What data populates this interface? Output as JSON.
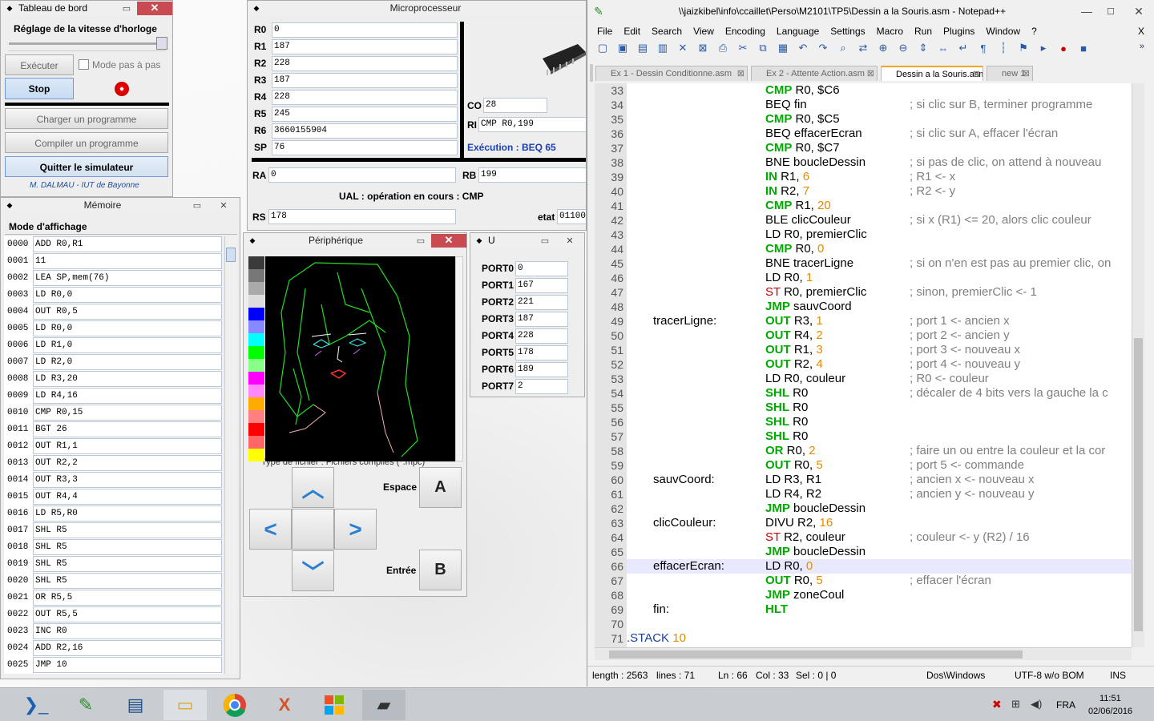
{
  "tableau": {
    "title": "Tableau de bord",
    "speed_label": "Réglage de la vitesse d'horloge",
    "exec": "Exécuter",
    "step": "Mode pas à pas",
    "stop": "Stop",
    "load": "Charger un programme",
    "compile": "Compiler un programme",
    "quit": "Quitter le simulateur",
    "credit": "M. DALMAU - IUT de Bayonne"
  },
  "memoire": {
    "title": "Mémoire",
    "mode": "Mode d'affichage",
    "rows": [
      {
        "a": "0000",
        "v": "ADD R0,R1"
      },
      {
        "a": "0001",
        "v": "11"
      },
      {
        "a": "0002",
        "v": "LEA SP,mem(76)"
      },
      {
        "a": "0003",
        "v": "LD R0,0"
      },
      {
        "a": "0004",
        "v": "OUT R0,5"
      },
      {
        "a": "0005",
        "v": "LD R0,0"
      },
      {
        "a": "0006",
        "v": "LD R1,0"
      },
      {
        "a": "0007",
        "v": "LD R2,0"
      },
      {
        "a": "0008",
        "v": "LD R3,20"
      },
      {
        "a": "0009",
        "v": "LD R4,16"
      },
      {
        "a": "0010",
        "v": "CMP R0,15"
      },
      {
        "a": "0011",
        "v": "BGT 26"
      },
      {
        "a": "0012",
        "v": "OUT R1,1"
      },
      {
        "a": "0013",
        "v": "OUT R2,2"
      },
      {
        "a": "0014",
        "v": "OUT R3,3"
      },
      {
        "a": "0015",
        "v": "OUT R4,4"
      },
      {
        "a": "0016",
        "v": "LD R5,R0"
      },
      {
        "a": "0017",
        "v": "SHL R5"
      },
      {
        "a": "0018",
        "v": "SHL R5"
      },
      {
        "a": "0019",
        "v": "SHL R5"
      },
      {
        "a": "0020",
        "v": "SHL R5"
      },
      {
        "a": "0021",
        "v": "OR R5,5"
      },
      {
        "a": "0022",
        "v": "OUT R5,5"
      },
      {
        "a": "0023",
        "v": "INC R0"
      },
      {
        "a": "0024",
        "v": "ADD R2,16"
      },
      {
        "a": "0025",
        "v": "JMP 10"
      }
    ]
  },
  "cpu": {
    "title": "Microprocesseur",
    "regs": [
      {
        "n": "R0",
        "v": "0"
      },
      {
        "n": "R1",
        "v": "187"
      },
      {
        "n": "R2",
        "v": "228"
      },
      {
        "n": "R3",
        "v": "187"
      },
      {
        "n": "R4",
        "v": "228"
      },
      {
        "n": "R5",
        "v": "245"
      },
      {
        "n": "R6",
        "v": "3660155904"
      },
      {
        "n": "SP",
        "v": "76"
      }
    ],
    "co_label": "CO",
    "co": "28",
    "ri_label": "RI",
    "ri": "CMP R0,199",
    "exec": "Exécution : BEQ 65",
    "ra_label": "RA",
    "ra": "0",
    "rb_label": "RB",
    "rb": "199",
    "ual": "UAL : opération en cours :  CMP",
    "rs_label": "RS",
    "rs": "178",
    "etat_label": "etat",
    "etat": "01100"
  },
  "peri": {
    "title": "Périphérique",
    "hidden_text": "Type de fichier :   Fichiers compilés (*.mpc)",
    "espace": "Espace",
    "entree": "Entrée",
    "a": "A",
    "b": "B"
  },
  "ports": {
    "title": "U",
    "rows": [
      {
        "n": "PORT0",
        "v": "0"
      },
      {
        "n": "PORT1",
        "v": "167"
      },
      {
        "n": "PORT2",
        "v": "221"
      },
      {
        "n": "PORT3",
        "v": "187"
      },
      {
        "n": "PORT4",
        "v": "228"
      },
      {
        "n": "PORT5",
        "v": "178"
      },
      {
        "n": "PORT6",
        "v": "189"
      },
      {
        "n": "PORT7",
        "v": "2"
      }
    ]
  },
  "npp": {
    "title": "\\\\jaizkibel\\info\\ccaillet\\Perso\\M2101\\TP5\\Dessin a la Souris.asm - Notepad++",
    "menu": [
      "File",
      "Edit",
      "Search",
      "View",
      "Encoding",
      "Language",
      "Settings",
      "Macro",
      "Run",
      "Plugins",
      "Window",
      "?"
    ],
    "tabs": [
      "Ex 1 - Dessin Conditionne.asm",
      "Ex 2 - Attente Action.asm",
      "Dessin a la Souris.asm",
      "new  1"
    ],
    "lines": [
      {
        "n": "33",
        "lab": "",
        "kw": "CMP",
        "k": "g",
        "rest": " R0, $C6",
        "cm": ""
      },
      {
        "n": "34",
        "lab": "",
        "kw": "BEQ",
        "k": "n",
        "rest": " fin",
        "cm": "; si clic sur B, terminer programme"
      },
      {
        "n": "35",
        "lab": "",
        "kw": "CMP",
        "k": "g",
        "rest": " R0, $C5",
        "cm": ""
      },
      {
        "n": "36",
        "lab": "",
        "kw": "BEQ",
        "k": "n",
        "rest": " effacerEcran",
        "cm": "; si clic sur A, effacer l'écran"
      },
      {
        "n": "37",
        "lab": "",
        "kw": "CMP",
        "k": "g",
        "rest": " R0, $C7",
        "cm": ""
      },
      {
        "n": "38",
        "lab": "",
        "kw": "BNE",
        "k": "n",
        "rest": " boucleDessin",
        "cm": "; si pas de clic, on attend à nouveau"
      },
      {
        "n": "39",
        "lab": "",
        "kw": "IN",
        "k": "g",
        "rest": " R1, ",
        "num": "6",
        "cm": "; R1 <- x"
      },
      {
        "n": "40",
        "lab": "",
        "kw": "IN",
        "k": "g",
        "rest": " R2, ",
        "num": "7",
        "cm": "; R2 <- y"
      },
      {
        "n": "41",
        "lab": "",
        "kw": "CMP",
        "k": "g",
        "rest": " R1, ",
        "num": "20",
        "cm": ""
      },
      {
        "n": "42",
        "lab": "",
        "kw": "BLE",
        "k": "n",
        "rest": " clicCouleur",
        "cm": "; si x (R1) <= 20, alors clic couleur"
      },
      {
        "n": "43",
        "lab": "",
        "kw": "LD",
        "k": "n",
        "rest": " R0, premierClic",
        "cm": ""
      },
      {
        "n": "44",
        "lab": "",
        "kw": "CMP",
        "k": "g",
        "rest": " R0, ",
        "num": "0",
        "cm": ""
      },
      {
        "n": "45",
        "lab": "",
        "kw": "BNE",
        "k": "n",
        "rest": " tracerLigne",
        "cm": "; si on n'en est pas au premier clic, on"
      },
      {
        "n": "46",
        "lab": "",
        "kw": "LD",
        "k": "n",
        "rest": " R0, ",
        "num": "1",
        "cm": ""
      },
      {
        "n": "47",
        "lab": "",
        "kw": "ST",
        "k": "r",
        "rest": " R0, premierClic",
        "cm": "; sinon, premierClic <- 1"
      },
      {
        "n": "48",
        "lab": "",
        "kw": "JMP",
        "k": "g",
        "rest": " sauvCoord",
        "cm": ""
      },
      {
        "n": "49",
        "lab": "tracerLigne:",
        "kw": "OUT",
        "k": "g",
        "rest": " R3, ",
        "num": "1",
        "cm": "; port 1 <- ancien x"
      },
      {
        "n": "50",
        "lab": "",
        "kw": "OUT",
        "k": "g",
        "rest": " R4, ",
        "num": "2",
        "cm": "; port 2 <- ancien y"
      },
      {
        "n": "51",
        "lab": "",
        "kw": "OUT",
        "k": "g",
        "rest": " R1, ",
        "num": "3",
        "cm": "; port 3 <- nouveau x"
      },
      {
        "n": "52",
        "lab": "",
        "kw": "OUT",
        "k": "g",
        "rest": " R2, ",
        "num": "4",
        "cm": "; port 4 <- nouveau y"
      },
      {
        "n": "53",
        "lab": "",
        "kw": "LD",
        "k": "n",
        "rest": " R0, couleur",
        "cm": "; R0 <- couleur"
      },
      {
        "n": "54",
        "lab": "",
        "kw": "SHL",
        "k": "g",
        "rest": " R0",
        "cm": "; décaler de 4 bits vers la gauche la c"
      },
      {
        "n": "55",
        "lab": "",
        "kw": "SHL",
        "k": "g",
        "rest": " R0",
        "cm": ""
      },
      {
        "n": "56",
        "lab": "",
        "kw": "SHL",
        "k": "g",
        "rest": " R0",
        "cm": ""
      },
      {
        "n": "57",
        "lab": "",
        "kw": "SHL",
        "k": "g",
        "rest": " R0",
        "cm": ""
      },
      {
        "n": "58",
        "lab": "",
        "kw": "OR",
        "k": "g",
        "rest": " R0, ",
        "num": "2",
        "cm": "; faire un ou entre la couleur et la cor"
      },
      {
        "n": "59",
        "lab": "",
        "kw": "OUT",
        "k": "g",
        "rest": " R0, ",
        "num": "5",
        "cm": "; port 5 <- commande"
      },
      {
        "n": "60",
        "lab": "sauvCoord:",
        "kw": "LD",
        "k": "n",
        "rest": " R3, R1",
        "cm": "; ancien x <- nouveau x"
      },
      {
        "n": "61",
        "lab": "",
        "kw": "LD",
        "k": "n",
        "rest": " R4, R2",
        "cm": "; ancien y <- nouveau y"
      },
      {
        "n": "62",
        "lab": "",
        "kw": "JMP",
        "k": "g",
        "rest": " boucleDessin",
        "cm": ""
      },
      {
        "n": "63",
        "lab": "clicCouleur:",
        "kw": "DIVU",
        "k": "n",
        "rest": " R2, ",
        "num": "16",
        "cm": ""
      },
      {
        "n": "64",
        "lab": "",
        "kw": "ST",
        "k": "r",
        "rest": " R2, couleur",
        "cm": "; couleur <- y (R2) / 16"
      },
      {
        "n": "65",
        "lab": "",
        "kw": "JMP",
        "k": "g",
        "rest": " boucleDessin",
        "cm": ""
      },
      {
        "n": "66",
        "lab": "effacerEcran:",
        "kw": "LD",
        "k": "n",
        "rest": " R0, ",
        "num": "0",
        "cm": ""
      },
      {
        "n": "67",
        "lab": "",
        "kw": "OUT",
        "k": "g",
        "rest": " R0, ",
        "num": "5",
        "cm": "; effacer l'écran"
      },
      {
        "n": "68",
        "lab": "",
        "kw": "JMP",
        "k": "g",
        "rest": " zoneCoul",
        "cm": ""
      },
      {
        "n": "69",
        "lab": "fin:",
        "kw": "HLT",
        "k": "g",
        "rest": "",
        "cm": ""
      },
      {
        "n": "70",
        "lab": "",
        "kw": "",
        "k": "n",
        "rest": "",
        "cm": ""
      },
      {
        "n": "71",
        "lab": ".STACK",
        "kw": "",
        "k": "n",
        "rest": "",
        "num": "10",
        "cm": "",
        "stack": true
      }
    ],
    "status": {
      "length": "length : 2563",
      "lines": "lines : 71",
      "ln": "Ln : 66",
      "col": "Col : 33",
      "sel": "Sel : 0 | 0",
      "eol": "Dos\\Windows",
      "enc": "UTF-8 w/o BOM",
      "ins": "INS"
    },
    "menu_close": "X"
  },
  "tray": {
    "lang": "FRA",
    "time": "11:51",
    "date": "02/06/2016"
  }
}
